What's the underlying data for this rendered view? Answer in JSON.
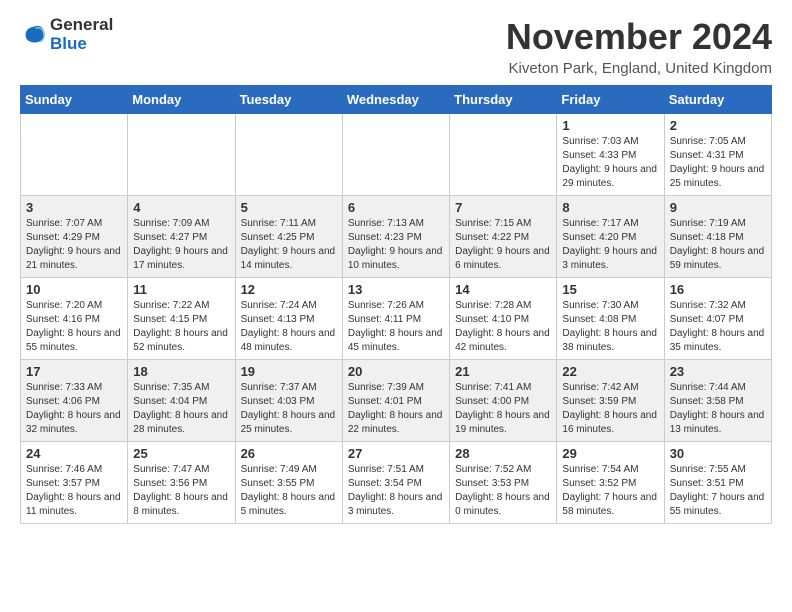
{
  "header": {
    "logo_general": "General",
    "logo_blue": "Blue",
    "month_title": "November 2024",
    "location": "Kiveton Park, England, United Kingdom"
  },
  "days_of_week": [
    "Sunday",
    "Monday",
    "Tuesday",
    "Wednesday",
    "Thursday",
    "Friday",
    "Saturday"
  ],
  "weeks": [
    [
      {
        "day": "",
        "info": ""
      },
      {
        "day": "",
        "info": ""
      },
      {
        "day": "",
        "info": ""
      },
      {
        "day": "",
        "info": ""
      },
      {
        "day": "",
        "info": ""
      },
      {
        "day": "1",
        "info": "Sunrise: 7:03 AM\nSunset: 4:33 PM\nDaylight: 9 hours and 29 minutes."
      },
      {
        "day": "2",
        "info": "Sunrise: 7:05 AM\nSunset: 4:31 PM\nDaylight: 9 hours and 25 minutes."
      }
    ],
    [
      {
        "day": "3",
        "info": "Sunrise: 7:07 AM\nSunset: 4:29 PM\nDaylight: 9 hours and 21 minutes."
      },
      {
        "day": "4",
        "info": "Sunrise: 7:09 AM\nSunset: 4:27 PM\nDaylight: 9 hours and 17 minutes."
      },
      {
        "day": "5",
        "info": "Sunrise: 7:11 AM\nSunset: 4:25 PM\nDaylight: 9 hours and 14 minutes."
      },
      {
        "day": "6",
        "info": "Sunrise: 7:13 AM\nSunset: 4:23 PM\nDaylight: 9 hours and 10 minutes."
      },
      {
        "day": "7",
        "info": "Sunrise: 7:15 AM\nSunset: 4:22 PM\nDaylight: 9 hours and 6 minutes."
      },
      {
        "day": "8",
        "info": "Sunrise: 7:17 AM\nSunset: 4:20 PM\nDaylight: 9 hours and 3 minutes."
      },
      {
        "day": "9",
        "info": "Sunrise: 7:19 AM\nSunset: 4:18 PM\nDaylight: 8 hours and 59 minutes."
      }
    ],
    [
      {
        "day": "10",
        "info": "Sunrise: 7:20 AM\nSunset: 4:16 PM\nDaylight: 8 hours and 55 minutes."
      },
      {
        "day": "11",
        "info": "Sunrise: 7:22 AM\nSunset: 4:15 PM\nDaylight: 8 hours and 52 minutes."
      },
      {
        "day": "12",
        "info": "Sunrise: 7:24 AM\nSunset: 4:13 PM\nDaylight: 8 hours and 48 minutes."
      },
      {
        "day": "13",
        "info": "Sunrise: 7:26 AM\nSunset: 4:11 PM\nDaylight: 8 hours and 45 minutes."
      },
      {
        "day": "14",
        "info": "Sunrise: 7:28 AM\nSunset: 4:10 PM\nDaylight: 8 hours and 42 minutes."
      },
      {
        "day": "15",
        "info": "Sunrise: 7:30 AM\nSunset: 4:08 PM\nDaylight: 8 hours and 38 minutes."
      },
      {
        "day": "16",
        "info": "Sunrise: 7:32 AM\nSunset: 4:07 PM\nDaylight: 8 hours and 35 minutes."
      }
    ],
    [
      {
        "day": "17",
        "info": "Sunrise: 7:33 AM\nSunset: 4:06 PM\nDaylight: 8 hours and 32 minutes."
      },
      {
        "day": "18",
        "info": "Sunrise: 7:35 AM\nSunset: 4:04 PM\nDaylight: 8 hours and 28 minutes."
      },
      {
        "day": "19",
        "info": "Sunrise: 7:37 AM\nSunset: 4:03 PM\nDaylight: 8 hours and 25 minutes."
      },
      {
        "day": "20",
        "info": "Sunrise: 7:39 AM\nSunset: 4:01 PM\nDaylight: 8 hours and 22 minutes."
      },
      {
        "day": "21",
        "info": "Sunrise: 7:41 AM\nSunset: 4:00 PM\nDaylight: 8 hours and 19 minutes."
      },
      {
        "day": "22",
        "info": "Sunrise: 7:42 AM\nSunset: 3:59 PM\nDaylight: 8 hours and 16 minutes."
      },
      {
        "day": "23",
        "info": "Sunrise: 7:44 AM\nSunset: 3:58 PM\nDaylight: 8 hours and 13 minutes."
      }
    ],
    [
      {
        "day": "24",
        "info": "Sunrise: 7:46 AM\nSunset: 3:57 PM\nDaylight: 8 hours and 11 minutes."
      },
      {
        "day": "25",
        "info": "Sunrise: 7:47 AM\nSunset: 3:56 PM\nDaylight: 8 hours and 8 minutes."
      },
      {
        "day": "26",
        "info": "Sunrise: 7:49 AM\nSunset: 3:55 PM\nDaylight: 8 hours and 5 minutes."
      },
      {
        "day": "27",
        "info": "Sunrise: 7:51 AM\nSunset: 3:54 PM\nDaylight: 8 hours and 3 minutes."
      },
      {
        "day": "28",
        "info": "Sunrise: 7:52 AM\nSunset: 3:53 PM\nDaylight: 8 hours and 0 minutes."
      },
      {
        "day": "29",
        "info": "Sunrise: 7:54 AM\nSunset: 3:52 PM\nDaylight: 7 hours and 58 minutes."
      },
      {
        "day": "30",
        "info": "Sunrise: 7:55 AM\nSunset: 3:51 PM\nDaylight: 7 hours and 55 minutes."
      }
    ]
  ]
}
